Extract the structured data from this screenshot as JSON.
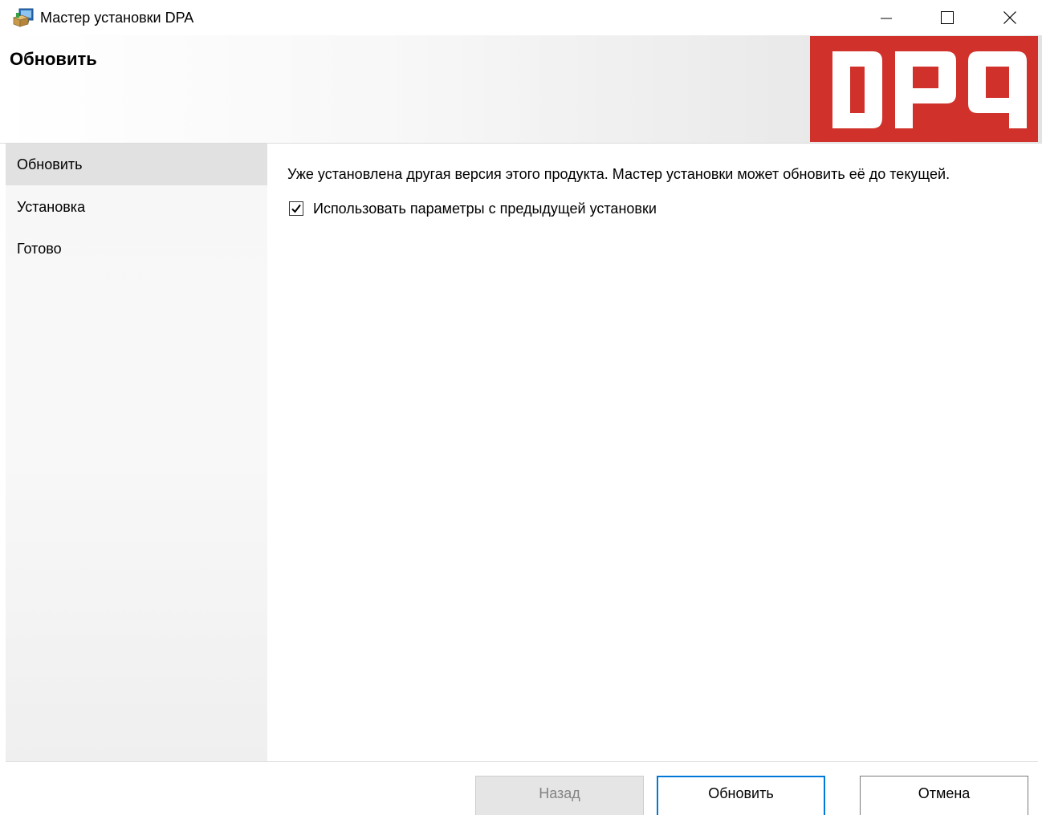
{
  "window": {
    "title": "Мастер установки DPA",
    "icon": "installer-package-icon",
    "controls": {
      "minimize": "minimize-icon",
      "maximize": "maximize-icon",
      "close": "close-icon"
    }
  },
  "banner": {
    "title": "Обновить",
    "logo_text": "DPA",
    "logo_color": "#d1312b"
  },
  "sidebar": {
    "steps": [
      {
        "label": "Обновить",
        "active": true
      },
      {
        "label": "Установка",
        "active": false
      },
      {
        "label": "Готово",
        "active": false
      }
    ]
  },
  "content": {
    "message": "Уже установлена другая версия этого продукта. Мастер установки может обновить её до текущей.",
    "checkbox": {
      "label": "Использовать параметры с предыдущей установки",
      "checked": true
    }
  },
  "footer": {
    "back_label": "Назад",
    "back_enabled": false,
    "primary_label": "Обновить",
    "cancel_label": "Отмена"
  },
  "colors": {
    "accent": "#0078d7",
    "brand": "#d1312b"
  }
}
